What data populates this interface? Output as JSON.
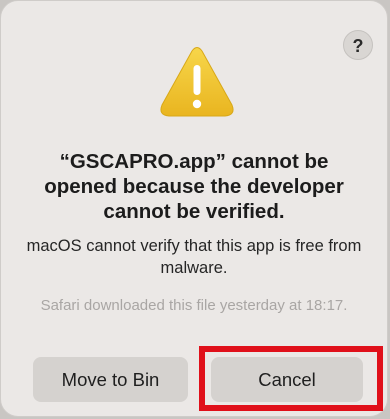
{
  "dialog": {
    "help_label": "?",
    "icon": "warning-triangle-icon",
    "title": "“GSCAPRO.app” cannot be opened because the developer cannot be verified.",
    "message": "macOS cannot verify that this app is free from malware.",
    "detail": "Safari downloaded this file yesterday at 18:17.",
    "buttons": {
      "move_to_bin": "Move to Bin",
      "cancel": "Cancel"
    }
  },
  "annotation": {
    "highlight_color": "#e0101a"
  },
  "colors": {
    "dialog_bg": "#ebe8e6",
    "button_bg": "#d5d2cf",
    "warning_yellow": "#f2c530",
    "detail_text": "#a9a6a4"
  }
}
